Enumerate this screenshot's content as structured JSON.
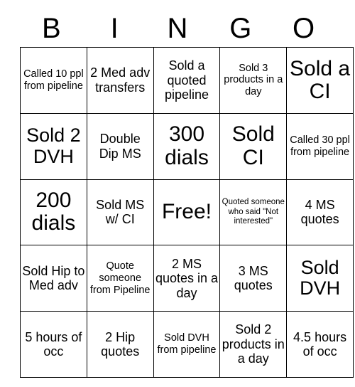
{
  "card": {
    "header_letters": [
      "B",
      "I",
      "N",
      "G",
      "O"
    ],
    "free_space_label": "Free!",
    "rows": [
      [
        {
          "text": "Called 10 ppl from pipeline",
          "size": "sm"
        },
        {
          "text": "2 Med adv transfers",
          "size": "md"
        },
        {
          "text": "Sold a quoted pipeline",
          "size": "md"
        },
        {
          "text": "Sold 3 products in a day",
          "size": "sm"
        },
        {
          "text": "Sold a CI",
          "size": "xl"
        }
      ],
      [
        {
          "text": "Sold 2 DVH",
          "size": "lg"
        },
        {
          "text": "Double Dip MS",
          "size": "md"
        },
        {
          "text": "300 dials",
          "size": "xl"
        },
        {
          "text": "Sold CI",
          "size": "xl"
        },
        {
          "text": "Called 30 ppl from pipeline",
          "size": "sm"
        }
      ],
      [
        {
          "text": "200 dials",
          "size": "xl"
        },
        {
          "text": "Sold MS w/ CI",
          "size": "md"
        },
        {
          "text": "Free!",
          "size": "xl"
        },
        {
          "text": "Quoted someone who said \"Not interested\"",
          "size": "xs"
        },
        {
          "text": "4 MS quotes",
          "size": "md"
        }
      ],
      [
        {
          "text": "Sold Hip to Med adv",
          "size": "md"
        },
        {
          "text": "Quote someone from Pipeline",
          "size": "sm"
        },
        {
          "text": "2 MS quotes in a day",
          "size": "md"
        },
        {
          "text": "3 MS quotes",
          "size": "md"
        },
        {
          "text": "Sold DVH",
          "size": "lg"
        }
      ],
      [
        {
          "text": "5 hours of occ",
          "size": "md"
        },
        {
          "text": "2 Hip quotes",
          "size": "md"
        },
        {
          "text": "Sold DVH from pipeline",
          "size": "sm"
        },
        {
          "text": "Sold 2 products in a day",
          "size": "md"
        },
        {
          "text": "4.5 hours of occ",
          "size": "md"
        }
      ]
    ]
  },
  "colors": {
    "background": "#ffffff",
    "text": "#000000",
    "border": "#000000"
  }
}
